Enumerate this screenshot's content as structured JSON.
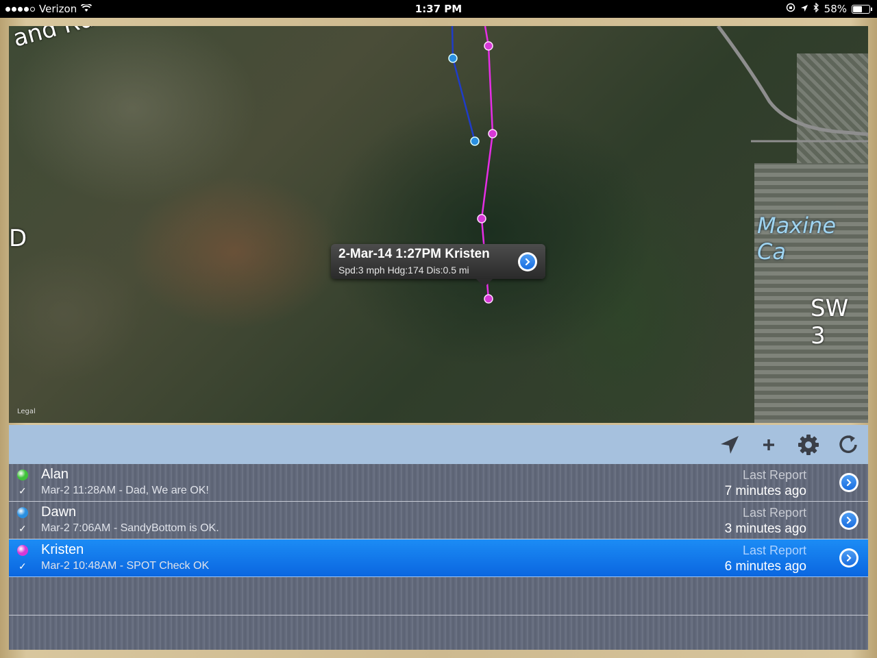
{
  "status_bar": {
    "carrier": "Verizon",
    "time": "1:37 PM",
    "battery": "58%",
    "battery_level": 0.58
  },
  "map": {
    "labels": {
      "road": "and Rd N",
      "maxine": "Maxine Ca",
      "sw": "SW 3",
      "d1": "D",
      "legal": "Legal"
    },
    "track_colors": {
      "blue": "#1f3cc8",
      "magenta": "#e62ee6"
    }
  },
  "callout": {
    "title": "2-Mar-14 1:27PM Kristen",
    "subtitle": "Spd:3 mph Hdg:174 Dis:0.5 mi"
  },
  "toolbar": {
    "icons": [
      "location-arrow-icon",
      "plus-icon",
      "gear-icon",
      "refresh-icon"
    ]
  },
  "list": {
    "rows": [
      {
        "name": "Alan",
        "message": "Mar-2 11:28AM - Dad, We are OK!",
        "last_report_label": "Last Report",
        "ago": "7 minutes ago",
        "color": "#3fc23a",
        "selected": false
      },
      {
        "name": "Dawn",
        "message": "Mar-2 7:06AM - SandyBottom is OK.",
        "last_report_label": "Last Report",
        "ago": "3 minutes ago",
        "color": "#2a8fe0",
        "selected": false
      },
      {
        "name": "Kristen",
        "message": "Mar-2 10:48AM - SPOT Check OK",
        "last_report_label": "Last Report",
        "ago": "6 minutes ago",
        "color": "#d638d6",
        "selected": true
      }
    ]
  }
}
